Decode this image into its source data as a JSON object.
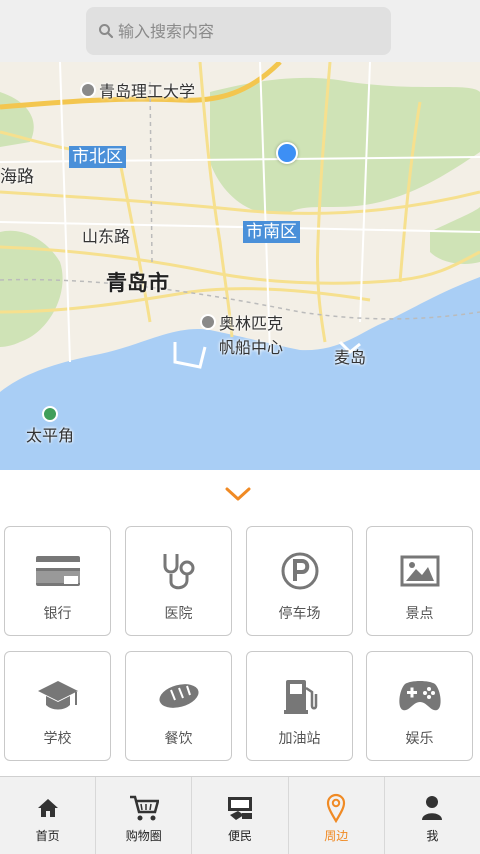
{
  "search": {
    "placeholder": "输入搜索内容"
  },
  "map": {
    "labels": {
      "university": "青岛理工大学",
      "shibei": "市北区",
      "huihai": "海路",
      "shandong": "山东路",
      "shinan": "市南区",
      "qingdao": "青岛市",
      "olympic_1": "奥林匹克",
      "olympic_2": "帆船中心",
      "maidao": "麦岛",
      "taipingjiao": "太平角"
    }
  },
  "categories": [
    {
      "id": "bank",
      "label": "银行",
      "icon": "credit-card-icon"
    },
    {
      "id": "hospital",
      "label": "医院",
      "icon": "stethoscope-icon"
    },
    {
      "id": "parking",
      "label": "停车场",
      "icon": "parking-icon"
    },
    {
      "id": "scenic",
      "label": "景点",
      "icon": "picture-icon"
    },
    {
      "id": "school",
      "label": "学校",
      "icon": "graduation-cap-icon"
    },
    {
      "id": "food",
      "label": "餐饮",
      "icon": "bread-icon"
    },
    {
      "id": "gas",
      "label": "加油站",
      "icon": "fuel-pump-icon"
    },
    {
      "id": "fun",
      "label": "娱乐",
      "icon": "gamepad-icon"
    }
  ],
  "tabs": [
    {
      "id": "home",
      "label": "首页",
      "icon": "home-icon",
      "active": false
    },
    {
      "id": "shopping",
      "label": "购物圈",
      "icon": "cart-icon",
      "active": false
    },
    {
      "id": "service",
      "label": "便民",
      "icon": "service-icon",
      "active": false
    },
    {
      "id": "nearby",
      "label": "周边",
      "icon": "location-pin-icon",
      "active": true
    },
    {
      "id": "me",
      "label": "我",
      "icon": "user-icon",
      "active": false
    }
  ],
  "colors": {
    "accent": "#f08a24",
    "district_tag": "#4a90d9",
    "location_dot": "#3d8ff5",
    "sea": "#a9cef5",
    "park": "#cfe3b6"
  }
}
